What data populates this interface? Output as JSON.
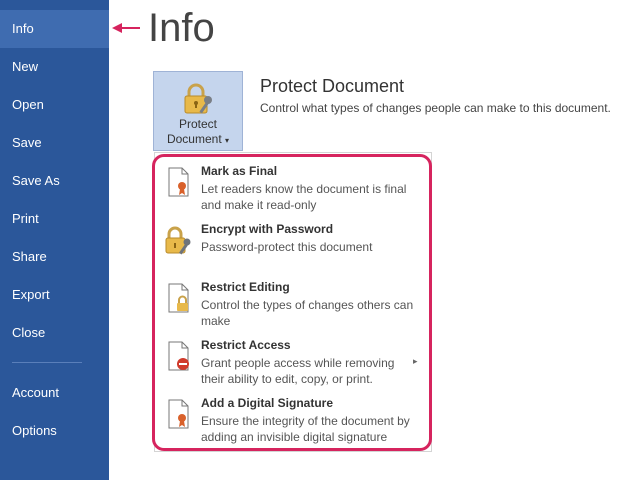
{
  "sidebar": {
    "items": [
      {
        "label": "Info",
        "active": true
      },
      {
        "label": "New"
      },
      {
        "label": "Open"
      },
      {
        "label": "Save"
      },
      {
        "label": "Save As"
      },
      {
        "label": "Print"
      },
      {
        "label": "Share"
      },
      {
        "label": "Export"
      },
      {
        "label": "Close"
      },
      {
        "label": "Account"
      },
      {
        "label": "Options"
      }
    ],
    "background_color": "#2b579a",
    "active_color": "#3f6cb0"
  },
  "page_title": "Info",
  "protect": {
    "button_line1": "Protect",
    "button_line2": "Document",
    "button_caret": "▾",
    "section_title": "Protect Document",
    "section_desc": "Control what types of changes people can make to this document."
  },
  "menu": {
    "items": [
      {
        "title": "Mark as Final",
        "desc": "Let readers know the document is final and make it read-only",
        "icon": "final-document-icon"
      },
      {
        "title": "Encrypt with Password",
        "desc": "Password-protect this document",
        "icon": "lock-key-icon"
      },
      {
        "title": "Restrict Editing",
        "desc": "Control the types of changes others can make",
        "icon": "restrict-editing-icon"
      },
      {
        "title": "Restrict Access",
        "desc": "Grant people access while removing their ability to edit, copy, or print.",
        "icon": "restrict-access-icon",
        "has_submenu": true
      },
      {
        "title": "Add a Digital Signature",
        "desc": "Ensure the integrity of the document by adding an invisible digital signature",
        "icon": "digital-signature-icon"
      }
    ],
    "highlight_color": "#d6245e"
  }
}
